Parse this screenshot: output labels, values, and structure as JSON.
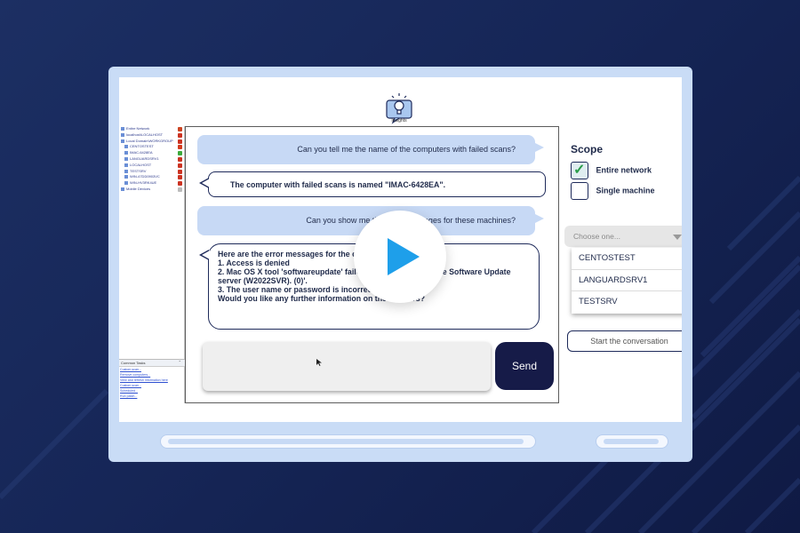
{
  "app": {
    "label": "Insights"
  },
  "tree": {
    "items": [
      {
        "label": "Entire Network",
        "status": "#cc4422"
      },
      {
        "label": "localhost\\LOCALHOST",
        "status": "#cc3322"
      },
      {
        "label": "Local Domain\\WORKGROUP",
        "status": "#cc3322"
      },
      {
        "label": "CENTOSTEST",
        "status": "#d43a1e"
      },
      {
        "label": "IMAC-6428EA",
        "status": "#3caa3c"
      },
      {
        "label": "LANGUARDSRV1",
        "status": "#cc3322"
      },
      {
        "label": "LOCALHOST",
        "status": "#cc3322"
      },
      {
        "label": "TESTSRV",
        "status": "#cc3322"
      },
      {
        "label": "WIN-47DD0903VC",
        "status": "#cc3322"
      },
      {
        "label": "WIN-HV3RK4UE",
        "status": "#cc3322"
      },
      {
        "label": "Mobile Devices",
        "status": "#bbbbbb"
      }
    ],
    "tasks_title": "Common Tasks",
    "tasks": [
      "Custom scan...",
      "Remove computers...",
      "View and refresh information here",
      "Custom scan...",
      "Scheduled...",
      "Run patch..."
    ]
  },
  "chat": {
    "messages": [
      {
        "role": "user",
        "lines": [
          "Can you tell me the name of the computers with failed scans?"
        ]
      },
      {
        "role": "assistant",
        "lines": [
          "The computer with failed scans is named \"IMAC-6428EA\"."
        ]
      },
      {
        "role": "user",
        "lines": [
          "Can you show me the error messages for these machines?"
        ]
      },
      {
        "role": "assistant",
        "lines": [
          "Here are the error messages for the computer:",
          "",
          "1. Access is denied",
          "2. Mac OS X tool 'softwareupdate' failed: 'Can't connect to the Software Update",
          "server (W2022SVR). (0)'.",
          "3. The user name or password is incorrect",
          "",
          "Would you like any further information on these errors?"
        ]
      }
    ],
    "input_value": "",
    "send_label": "Send"
  },
  "scope": {
    "title": "Scope",
    "options": [
      {
        "label": "Entire network",
        "checked": true
      },
      {
        "label": "Single machine",
        "checked": false
      }
    ],
    "dropdown_placeholder": "Choose one...",
    "machines": [
      "CENTOSTEST",
      "LANGUARDSRV1",
      "TESTSRV"
    ],
    "start_label": "Start the conversation"
  },
  "colors": {
    "background": "#1a2a5e",
    "frame": "#c9dcf6",
    "user_bubble": "#c7d9f5",
    "send_button": "#161b48",
    "play_icon": "#1e9fea",
    "check": "#2a9d4a"
  }
}
